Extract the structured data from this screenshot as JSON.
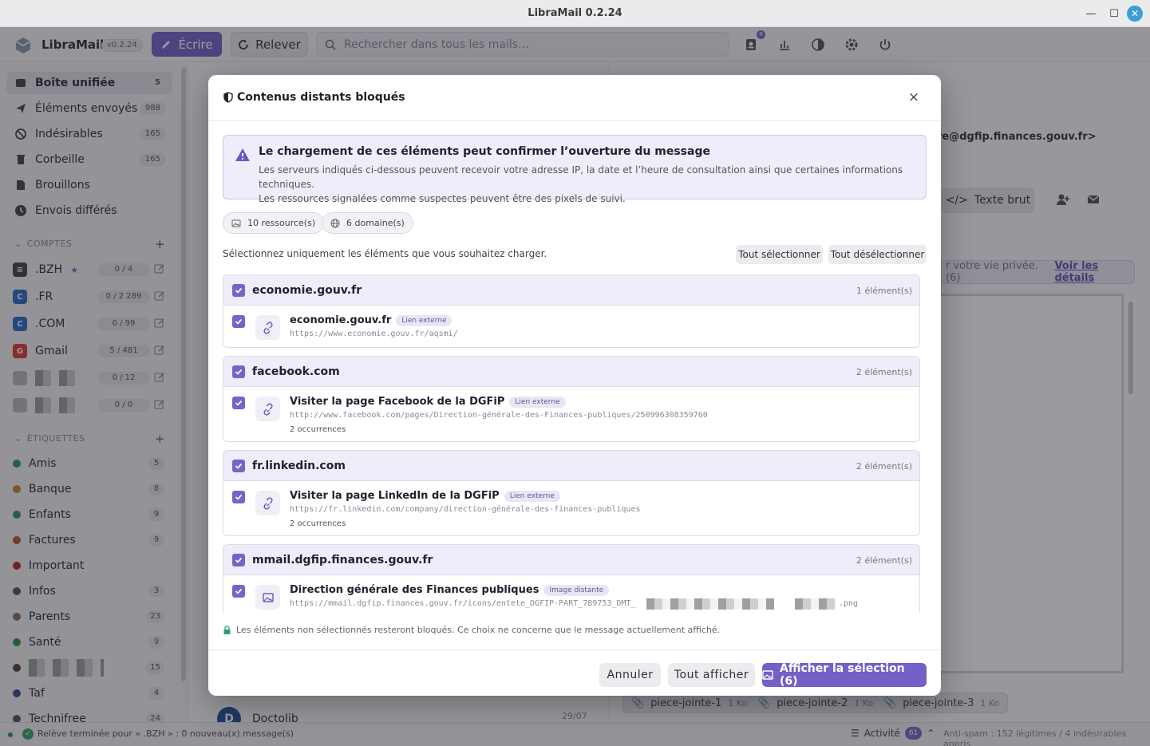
{
  "window": {
    "title": "LibraMail 0.2.24"
  },
  "toolbar": {
    "app_name": "LibraMail",
    "version": "v0.2.24",
    "write_label": "Écrire",
    "fetch_label": "Relever",
    "search_placeholder": "Rechercher dans tous les mails…",
    "notif_count": "4"
  },
  "sidebar": {
    "folders": [
      {
        "label": "Boîte unifiée",
        "count": "5",
        "icon": "inbox-icon"
      },
      {
        "label": "Éléments envoyés",
        "count": "988",
        "icon": "send-icon"
      },
      {
        "label": "Indésirables",
        "count": "165",
        "icon": "ban-icon"
      },
      {
        "label": "Corbeille",
        "count": "165",
        "icon": "trash-icon"
      },
      {
        "label": "Brouillons",
        "count": "",
        "icon": "draft-icon"
      },
      {
        "label": "Envois différés",
        "count": "",
        "icon": "clock-icon"
      }
    ],
    "accounts_title": "COMPTES",
    "accounts": [
      {
        "label": ".BZH",
        "count": "0 / 4",
        "starred": true
      },
      {
        "label": ".FR",
        "count": "0 / 2 289"
      },
      {
        "label": ".COM",
        "count": "0 / 99"
      },
      {
        "label": "Gmail",
        "count": "5 / 481"
      },
      {
        "label": "",
        "count": "0 / 12"
      },
      {
        "label": "",
        "count": "0 / 0"
      }
    ],
    "tags_title": "ÉTIQUETTES",
    "tags": [
      {
        "label": "Amis",
        "count": "5",
        "color": "#2f8f7a"
      },
      {
        "label": "Banque",
        "count": "8",
        "color": "#c9861a"
      },
      {
        "label": "Enfants",
        "count": "9",
        "color": "#2f8f7a"
      },
      {
        "label": "Factures",
        "count": "9",
        "color": "#b9532f"
      },
      {
        "label": "Important",
        "count": "",
        "color": "#c41e1e"
      },
      {
        "label": "Infos",
        "count": "3",
        "color": "#4a5568"
      },
      {
        "label": "Parents",
        "count": "23",
        "color": "#8c6e5a"
      },
      {
        "label": "Santé",
        "count": "9",
        "color": "#2f8f4a"
      },
      {
        "label": "",
        "count": "15",
        "color": "#5a3e2b"
      },
      {
        "label": "Taf",
        "count": "4",
        "color": "#3a4a8f"
      },
      {
        "label": "Technifree",
        "count": "24",
        "color": "#4a5568"
      }
    ]
  },
  "list": {
    "item_sender": "Doctolib",
    "item_date": "29/07",
    "item_logo": "D"
  },
  "reader": {
    "from_partial": "re@dgfip.finances.gouv.fr>",
    "plain_text_label": "Texte brut",
    "privacy_text": "r votre vie privée. (6)",
    "privacy_link": "Voir les détails",
    "attachments": [
      {
        "name": "piece-jointe-1",
        "size": "1 Ko"
      },
      {
        "name": "piece-jointe-2",
        "size": "1 Ko"
      },
      {
        "name": "piece-jointe-3",
        "size": "1 Ko"
      }
    ]
  },
  "status": {
    "text": "Relève terminée pour « .BZH » : 0 nouveau(x) message(s)",
    "activity_label": "Activité",
    "activity_count": "61",
    "antispam": "Anti-spam : 152 légitimes / 4 indésirables appris"
  },
  "modal": {
    "title": "Contenus distants bloqués",
    "close": "×",
    "warning_title": "Le chargement de ces éléments peut confirmer l’ouverture du message",
    "warning_line1": "Les serveurs indiqués ci-dessous peuvent recevoir votre adresse IP, la date et l’heure de consultation ainsi que certaines informations techniques.",
    "warning_line2": "Les ressources signalées comme suspectes peuvent être des pixels de suivi.",
    "resources_chip": "10 ressource(s)",
    "domains_chip": "6 domaine(s)",
    "instruction": "Sélectionnez uniquement les éléments que vous souhaitez charger.",
    "select_all": "Tout sélectionner",
    "deselect_all": "Tout désélectionner",
    "groups": [
      {
        "domain": "economie.gouv.fr",
        "count": "1 élément(s)",
        "item": {
          "title": "economie.gouv.fr",
          "badge": "Lien externe",
          "url": "https://www.economie.gouv.fr/aqsmi/",
          "occ": "",
          "icon": "link-icon"
        }
      },
      {
        "domain": "facebook.com",
        "count": "2 élément(s)",
        "item": {
          "title": "Visiter la page Facebook de la DGFiP",
          "badge": "Lien externe",
          "url": "http://www.facebook.com/pages/Direction-générale-des-Finances-publiques/250996308359760",
          "occ": "2 occurrences",
          "icon": "link-icon"
        }
      },
      {
        "domain": "fr.linkedin.com",
        "count": "2 élément(s)",
        "item": {
          "title": "Visiter la page LinkedIn de la DGFiP",
          "badge": "Lien externe",
          "url": "https://fr.linkedin.com/company/direction-générale-des-finances-publiques",
          "occ": "2 occurrences",
          "icon": "link-icon"
        }
      },
      {
        "domain": "mmail.dgfip.finances.gouv.fr",
        "count": "2 élément(s)",
        "item": {
          "title": "Direction générale des Finances publiques",
          "badge": "Image distante",
          "url": "https://mmail.dgfip.finances.gouv.fr/icons/entete_DGFIP-PART_789753_DMT_",
          "url_end": ".png",
          "occ": "",
          "icon": "image-icon"
        }
      }
    ],
    "note": "Les éléments non sélectionnés resteront bloqués. Ce choix ne concerne que le message actuellement affiché.",
    "cancel": "Annuler",
    "show_all": "Tout afficher",
    "show_selection": "Afficher la sélection (6)"
  }
}
